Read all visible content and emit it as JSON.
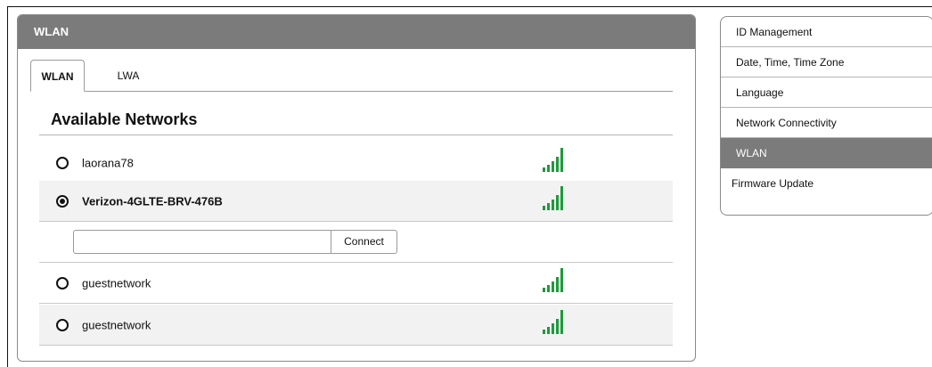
{
  "panel": {
    "title": "WLAN"
  },
  "tabs": [
    {
      "label": "WLAN",
      "active": true
    },
    {
      "label": "LWA",
      "active": false
    }
  ],
  "section": {
    "title": "Available Networks"
  },
  "networks": [
    {
      "ssid": "laorana78",
      "selected": false,
      "signal_bars": 5
    },
    {
      "ssid": "Verizon-4GLTE-BRV-476B",
      "selected": true,
      "signal_bars": 5
    },
    {
      "ssid": "guestnetwork",
      "selected": false,
      "signal_bars": 5
    },
    {
      "ssid": "guestnetwork",
      "selected": false,
      "signal_bars": 5
    }
  ],
  "connect": {
    "password_value": "",
    "button_label": "Connect"
  },
  "menu": {
    "items": [
      {
        "label": "ID Management"
      },
      {
        "label": "Date, Time, Time Zone"
      },
      {
        "label": "Language"
      },
      {
        "label": "Network Connectivity"
      },
      {
        "label": "WLAN",
        "active": true
      },
      {
        "label": "Firmware Update"
      }
    ]
  },
  "colors": {
    "header": "#7b7b7b",
    "signal": "#1e9a3c",
    "active_menu": "#7b7b7b"
  }
}
